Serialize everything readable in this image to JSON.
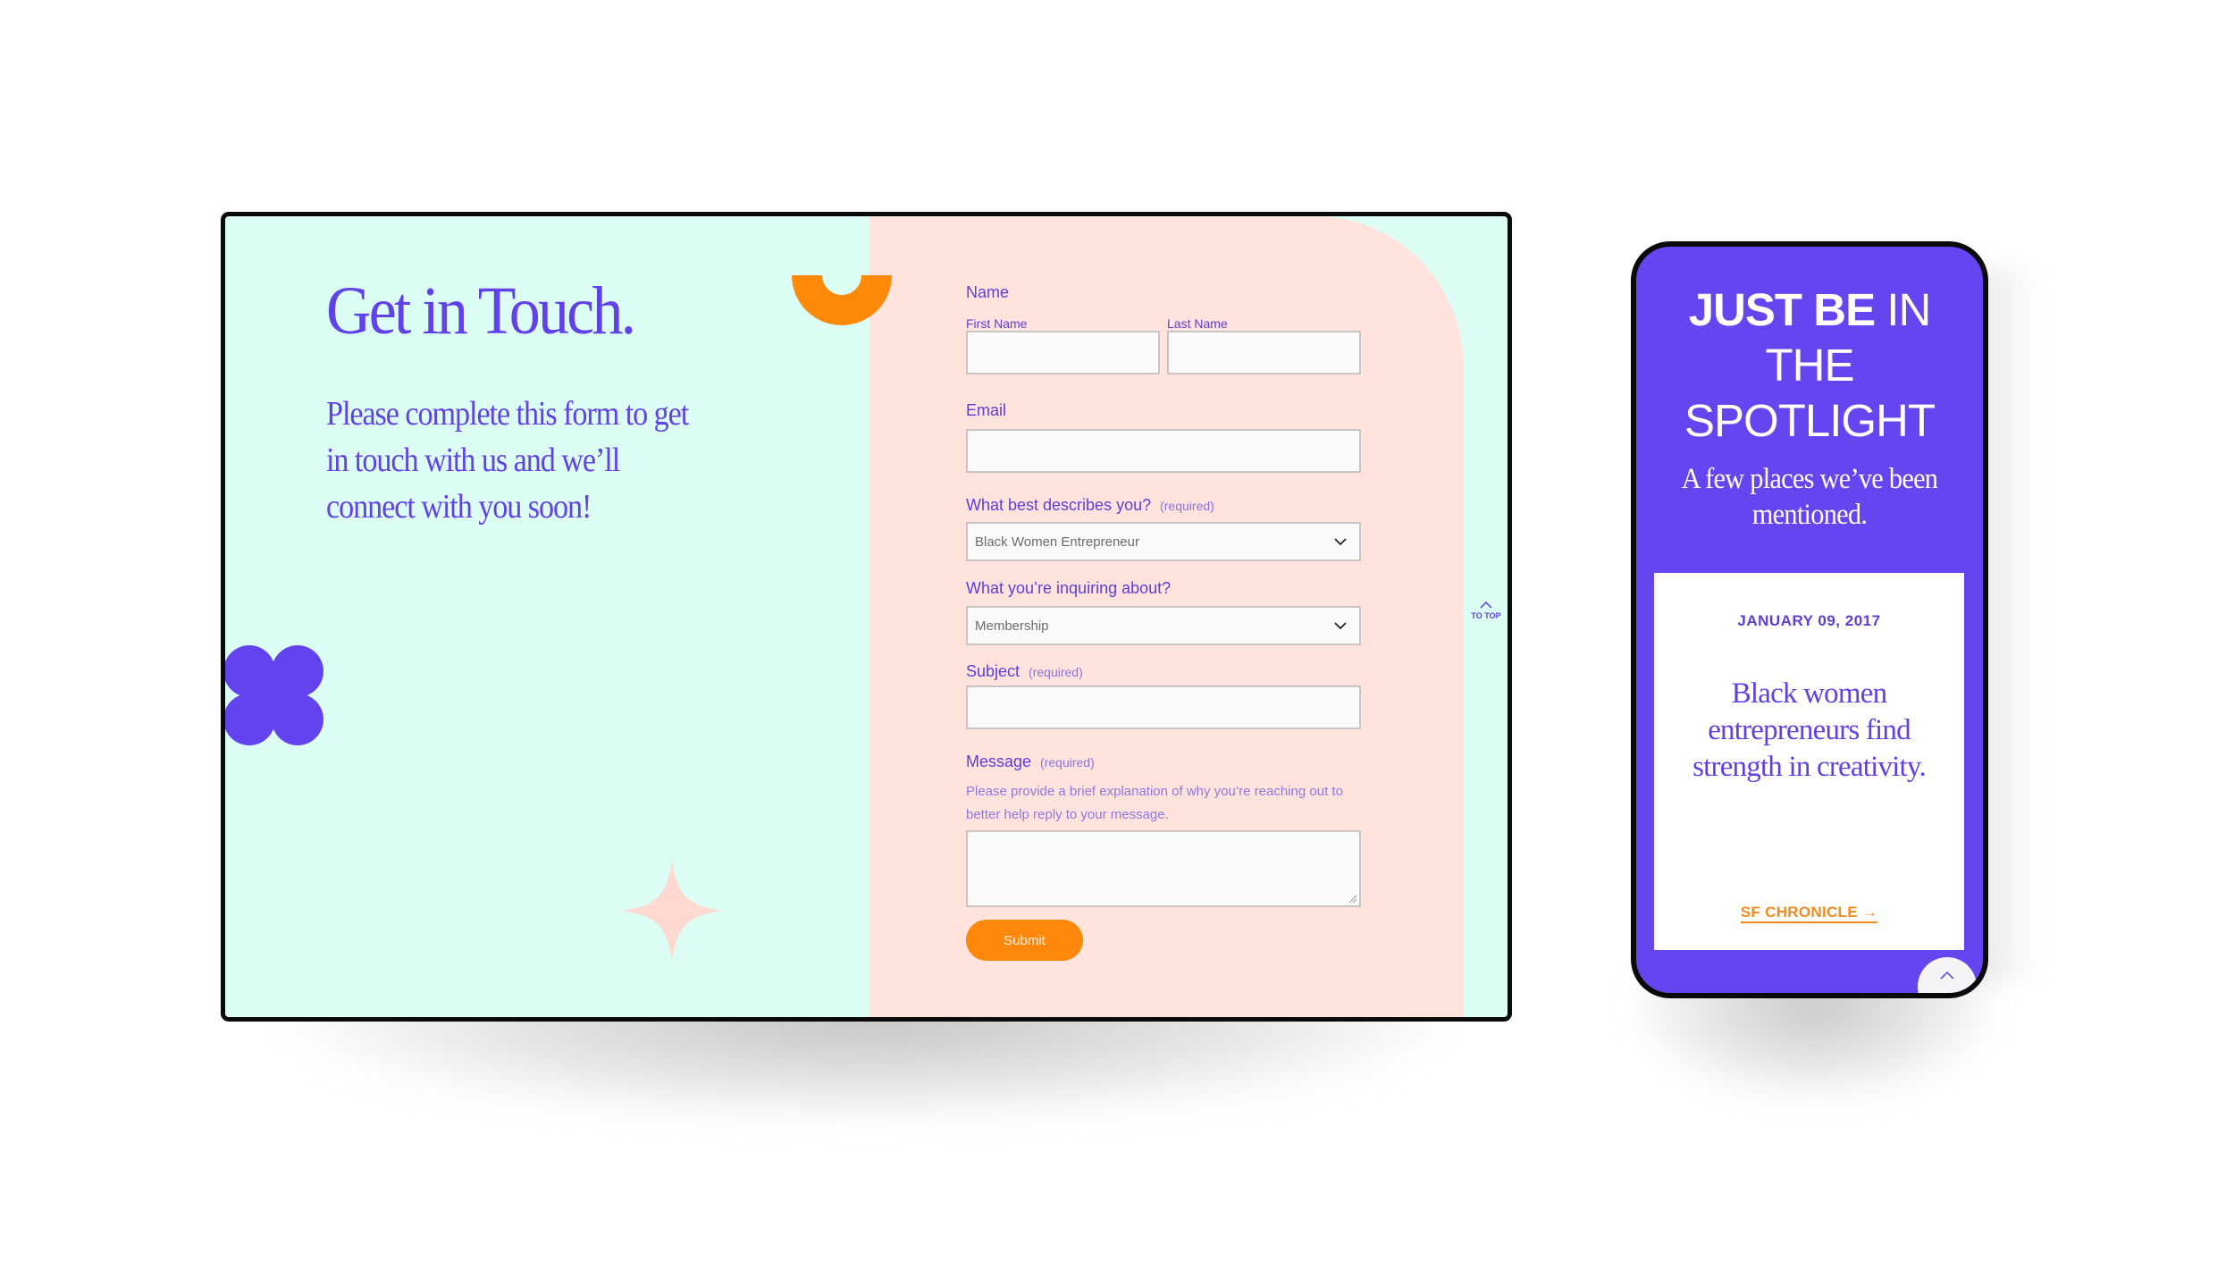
{
  "colors": {
    "purple": "#6142e8",
    "mint": "#dcfdf4",
    "peach": "#ffe3dc",
    "orange": "#ff880c",
    "phone_bg": "#6545ef",
    "link_orange": "#f28a1e"
  },
  "desktop": {
    "heading": "Get in Touch.",
    "intro": "Please complete this form to get in touch with us and we’ll connect with you soon!",
    "decorations": [
      "orange-half-ring",
      "purple-flower",
      "pink-sparkle"
    ],
    "form": {
      "name": {
        "label": "Name",
        "first_label": "First Name",
        "first_value": "",
        "last_label": "Last Name",
        "last_value": ""
      },
      "email": {
        "label": "Email",
        "value": ""
      },
      "describes": {
        "label": "What best describes you?",
        "required": "(required)",
        "selected": "Black Women Entrepreneur",
        "icon": "chevron-down-icon"
      },
      "inquiring": {
        "label": "What you’re inquiring about?",
        "selected": "Membership",
        "icon": "chevron-down-icon"
      },
      "subject": {
        "label": "Subject",
        "required": "(required)",
        "value": ""
      },
      "message": {
        "label": "Message",
        "required": "(required)",
        "help": "Please provide a brief explanation of why you’re reaching out to better help reply to your message.",
        "value": ""
      },
      "submit_label": "Submit"
    },
    "to_top": {
      "label": "TO TOP",
      "icon": "chevron-up-icon"
    }
  },
  "phone": {
    "title_bold": "JUST BE",
    "title_light_1": "IN",
    "title_light_2": "THE SPOTLIGHT",
    "subtitle": "A few places we’ve been mentioned.",
    "card": {
      "date": "JANUARY 09, 2017",
      "headline": "Black women entrepreneurs find strength in creativity.",
      "link": "SF CHRONICLE →"
    },
    "scroll_top_icon": "chevron-up-icon"
  }
}
